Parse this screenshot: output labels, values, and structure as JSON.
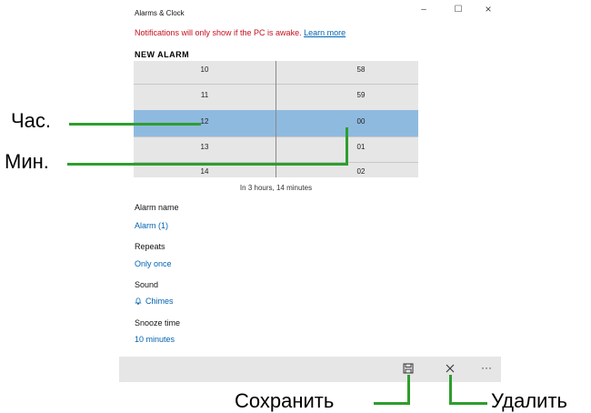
{
  "app": {
    "title": "Alarms & Clock"
  },
  "window_controls": {
    "minimize": "–",
    "maximize": "☐",
    "close": "×"
  },
  "notice": {
    "text": "Notifications will only show if the PC is awake.",
    "link": "Learn more"
  },
  "heading": "NEW ALARM",
  "picker": {
    "hours": [
      "10",
      "11",
      "12",
      "13",
      "14"
    ],
    "minutes": [
      "58",
      "59",
      "00",
      "01",
      "02"
    ],
    "selected_hour": "12",
    "selected_minute": "00"
  },
  "remaining": "In 3 hours, 14 minutes",
  "fields": {
    "alarm_name": {
      "label": "Alarm name",
      "value": "Alarm (1)"
    },
    "repeats": {
      "label": "Repeats",
      "value": "Only once"
    },
    "sound": {
      "label": "Sound",
      "value": "Chimes",
      "icon": "bell-icon"
    },
    "snooze": {
      "label": "Snooze time",
      "value": "10 minutes"
    }
  },
  "commandbar": {
    "save_icon": "save-icon",
    "delete_icon": "close-icon",
    "more": "···"
  },
  "annotations": {
    "hour": "Час.",
    "minute": "Мин.",
    "save": "Сохранить",
    "delete": "Удалить"
  },
  "colors": {
    "accent": "#0063b1",
    "warning": "#c50f1f",
    "selection": "#8fbae0",
    "annotation_line": "#2e9e2e"
  }
}
